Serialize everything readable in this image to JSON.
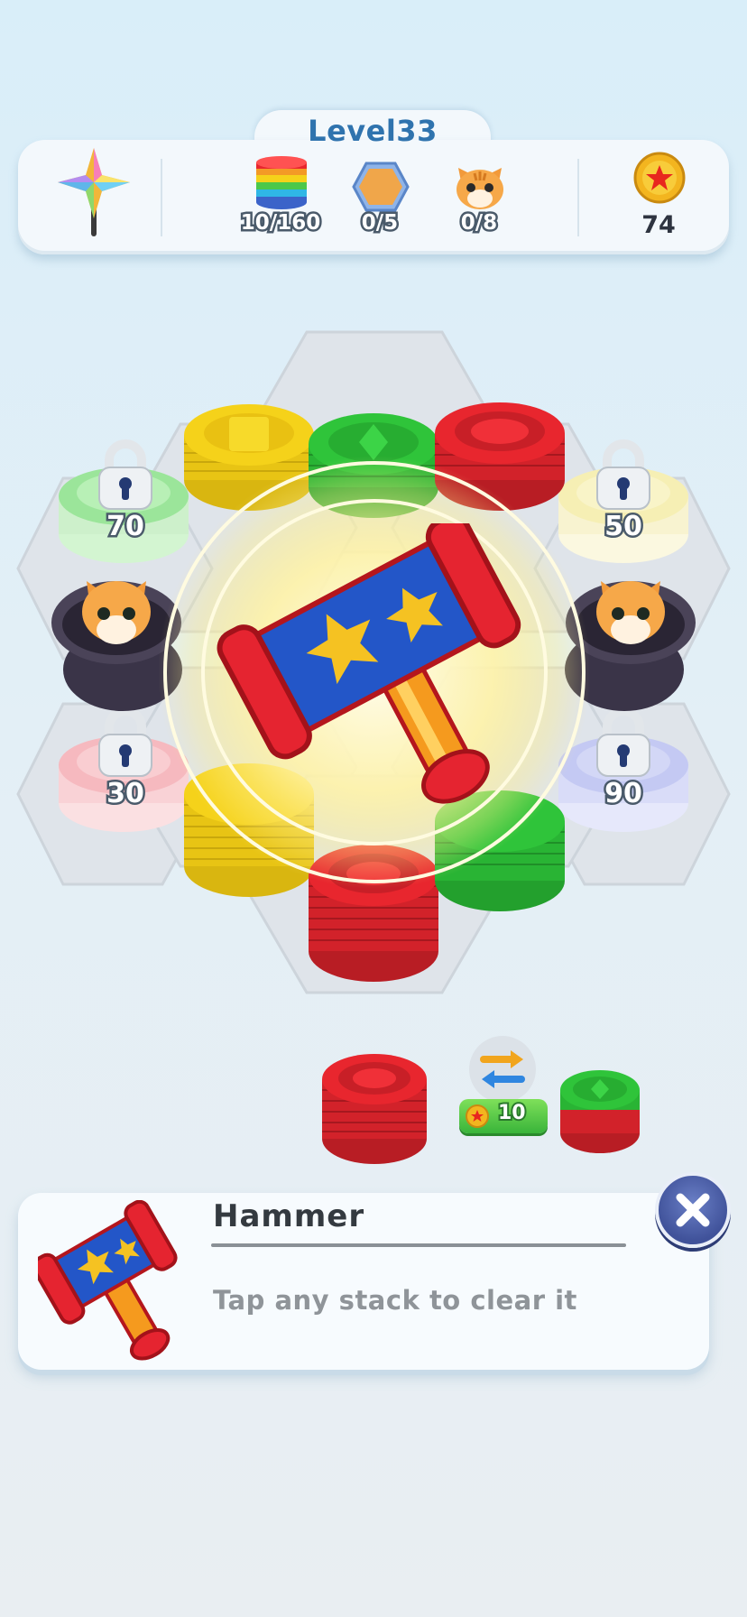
{
  "header": {
    "level_title": "Level33",
    "goals": [
      {
        "icon": "rainbow-stack-icon",
        "label": "10/160"
      },
      {
        "icon": "hexagon-tile-icon",
        "label": "0/5"
      },
      {
        "icon": "cat-icon",
        "label": "0/8"
      }
    ],
    "wand_icon": "star-wand-icon",
    "coin_icon": "coin-icon",
    "coins": "74"
  },
  "board": {
    "locked_stacks": [
      {
        "side": "left-upper",
        "unlock": "70",
        "color": "#9be59a"
      },
      {
        "side": "right-upper",
        "unlock": "50",
        "color": "#f6efb4"
      },
      {
        "side": "left-lower",
        "unlock": "30",
        "color": "#f6b9bf"
      },
      {
        "side": "right-lower",
        "unlock": "90",
        "color": "#c4c9f3"
      }
    ],
    "cat_holes": [
      "left",
      "right"
    ],
    "stacks": [
      {
        "color": "yellow",
        "symbol": "square"
      },
      {
        "color": "green",
        "symbol": "diamond"
      },
      {
        "color": "red",
        "symbol": "ring"
      },
      {
        "color": "yellow",
        "symbol": "square"
      },
      {
        "color": "red",
        "symbol": "ring"
      },
      {
        "color": "green",
        "symbol": "diamond"
      }
    ],
    "active_booster": "hammer-icon"
  },
  "dock": {
    "slots": [
      {
        "color": "red",
        "symbol": "ring"
      },
      {
        "color": "green-red",
        "symbol": "diamond"
      }
    ],
    "swap_icon": "swap-arrows-icon",
    "swap_price": "10"
  },
  "tooltip": {
    "title": "Hammer",
    "description": "Tap any stack to clear it",
    "icon": "hammer-icon"
  },
  "colors": {
    "red": "#e8262e",
    "green": "#2fc43a",
    "yellow": "#f5d21a",
    "accent": "#2f73ae",
    "close": "#40529a"
  }
}
